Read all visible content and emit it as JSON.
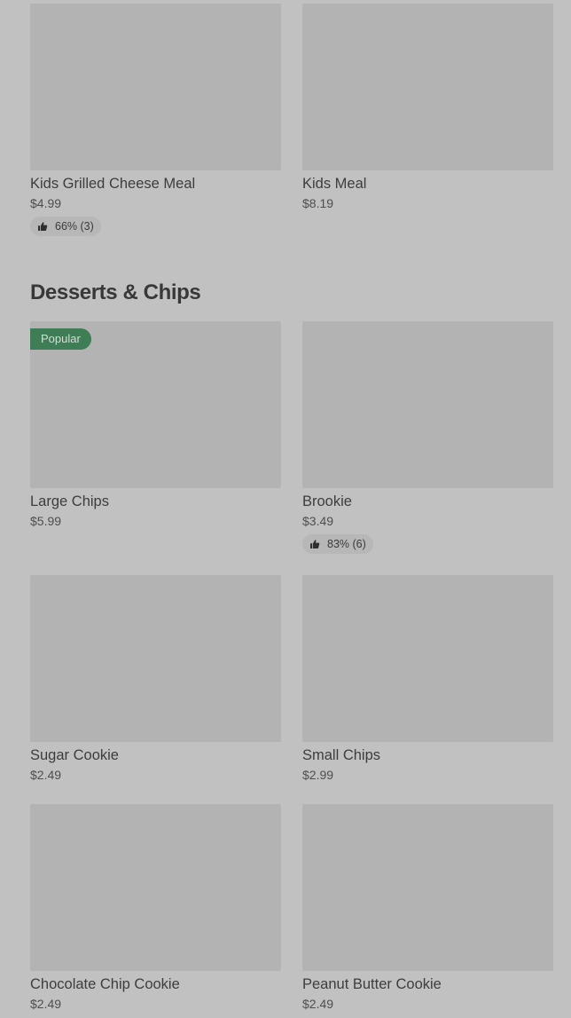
{
  "section": {
    "title": "Desserts & Chips"
  },
  "items": [
    {
      "name": "Kids Grilled Cheese Meal",
      "price": "$4.99",
      "rating": "66% (3)",
      "badge": ""
    },
    {
      "name": "Kids Meal",
      "price": "$8.19",
      "rating": "",
      "badge": ""
    },
    {
      "name": "Large Chips",
      "price": "$5.99",
      "rating": "",
      "badge": "Popular"
    },
    {
      "name": "Brookie",
      "price": "$3.49",
      "rating": "83% (6)",
      "badge": ""
    },
    {
      "name": "Sugar Cookie",
      "price": "$2.49",
      "rating": "",
      "badge": ""
    },
    {
      "name": "Small Chips",
      "price": "$2.99",
      "rating": "",
      "badge": ""
    },
    {
      "name": "Chocolate Chip Cookie",
      "price": "$2.49",
      "rating": "",
      "badge": ""
    },
    {
      "name": "Peanut Butter Cookie",
      "price": "$2.49",
      "rating": "",
      "badge": ""
    }
  ],
  "icons": {
    "rating": "thumbs-up-icon"
  },
  "colors": {
    "background": "#c1c1c1",
    "image_placeholder": "#b3b3b3",
    "popular_badge": "#3e7d55",
    "rating_pill": "#b7b7b7"
  }
}
